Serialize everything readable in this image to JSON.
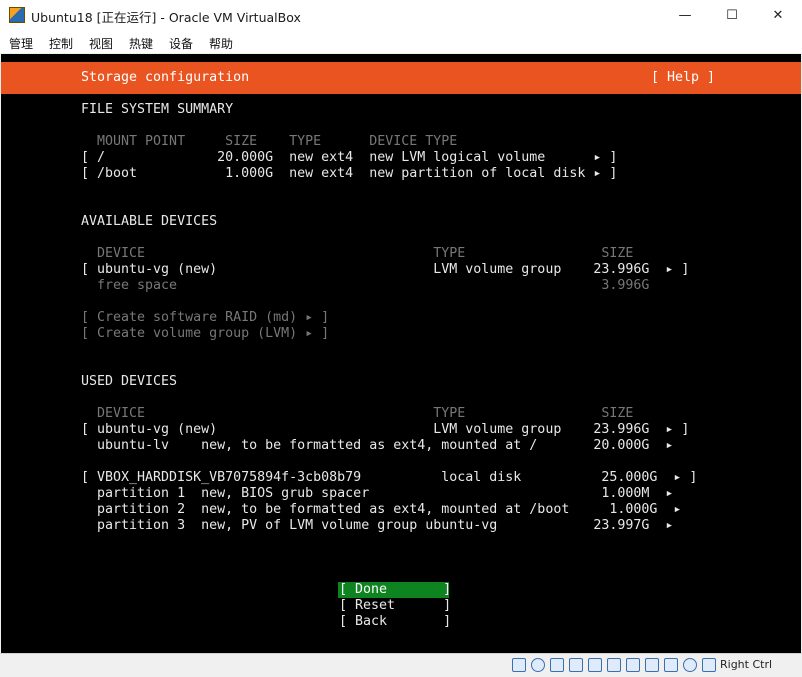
{
  "window": {
    "title": "Ubuntu18 [正在运行] - Oracle VM VirtualBox",
    "minimize": "—",
    "maximize": "☐",
    "close": "✕"
  },
  "menu": [
    "管理",
    "控制",
    "视图",
    "热键",
    "设备",
    "帮助"
  ],
  "installer": {
    "title": "Storage configuration",
    "help": "[ Help ]",
    "fs_summary": {
      "heading": "FILE SYSTEM SUMMARY",
      "columns": "  MOUNT POINT     SIZE    TYPE      DEVICE TYPE",
      "rows": [
        "[ /              20.000G  new ext4  new LVM logical volume      ▸ ]",
        "[ /boot           1.000G  new ext4  new partition of local disk ▸ ]"
      ]
    },
    "available": {
      "heading": "AVAILABLE DEVICES",
      "columns": "  DEVICE                                    TYPE                 SIZE",
      "rows": [
        "[ ubuntu-vg (new)                           LVM volume group    23.996G  ▸ ]"
      ],
      "free": "  free space                                                     3.996G",
      "actions": [
        "[ Create software RAID (md) ▸ ]",
        "[ Create volume group (LVM) ▸ ]"
      ]
    },
    "used": {
      "heading": "USED DEVICES",
      "columns": "  DEVICE                                    TYPE                 SIZE",
      "rows": [
        "[ ubuntu-vg (new)                           LVM volume group    23.996G  ▸ ]",
        "  ubuntu-lv    new, to be formatted as ext4, mounted at /       20.000G  ▸",
        "[ VBOX_HARDDISK_VB7075894f-3cb08b79          local disk          25.000G  ▸ ]",
        "  partition 1  new, BIOS grub spacer                             1.000M  ▸",
        "  partition 2  new, to be formatted as ext4, mounted at /boot     1.000G  ▸",
        "  partition 3  new, PV of LVM volume group ubuntu-vg            23.997G  ▸"
      ]
    },
    "buttons": {
      "done": "[ Done       ]",
      "reset": "[ Reset      ]",
      "back": "[ Back       ]"
    }
  },
  "statusbar": {
    "host_key": "Right Ctrl"
  }
}
